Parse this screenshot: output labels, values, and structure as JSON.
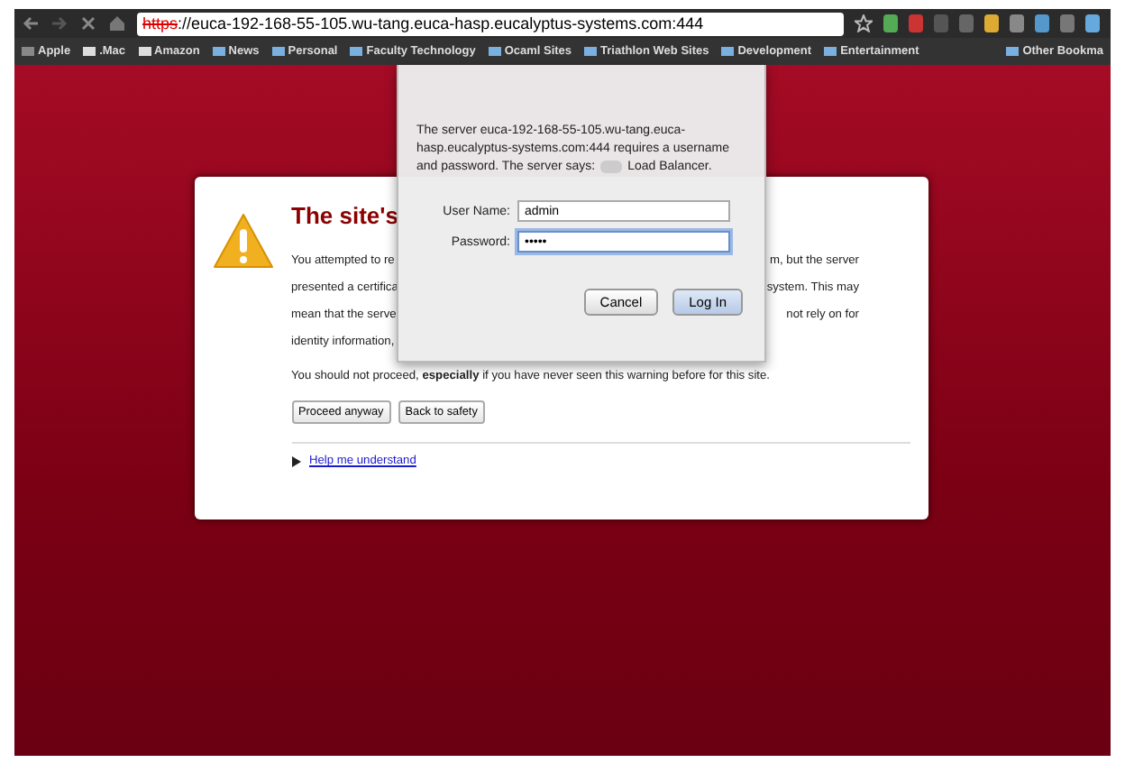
{
  "toolbar": {
    "url_scheme": "https",
    "url_rest": "://euca-192-168-55-105.wu-tang.euca-hasp.eucalyptus-systems.com:444",
    "scheme_insecure": true
  },
  "bookmarks": [
    {
      "label": "Apple",
      "kind": "apple"
    },
    {
      "label": ".Mac",
      "kind": "page"
    },
    {
      "label": "Amazon",
      "kind": "page"
    },
    {
      "label": "News",
      "kind": "folder"
    },
    {
      "label": "Personal",
      "kind": "folder"
    },
    {
      "label": "Faculty Technology",
      "kind": "folder"
    },
    {
      "label": "Ocaml Sites",
      "kind": "folder"
    },
    {
      "label": "Triathlon Web Sites",
      "kind": "folder"
    },
    {
      "label": "Development",
      "kind": "folder"
    },
    {
      "label": "Entertainment",
      "kind": "folder"
    }
  ],
  "other_bookmarks": "Other Bookma",
  "warning": {
    "title": "The site's",
    "lines": [
      {
        "left": "You attempted to re",
        "right": "m, but the server"
      },
      {
        "left": "presented a certifica",
        "right": "system. This may"
      },
      {
        "left": "mean that the serve",
        "right": "not rely on for"
      },
      {
        "left": "identity information,"
      }
    ],
    "advice": "You should not proceed, **especially** if you have never seen this warning before for this site.",
    "buttons": [
      "Proceed anyway",
      "Back to safety"
    ],
    "help_link": "Help me understand",
    "help_expanded": false
  },
  "dialog": {
    "message": "The server euca-192-168-55-105.wu-tang.euca-hasp.eucalyptus-systems.com:444 requires a username and password. The server says:",
    "message_end": "Load Balancer.",
    "fields": [
      {
        "label": "User Name:",
        "value": "admin",
        "focused": false
      },
      {
        "label": "Password:",
        "value": "•••••",
        "focused": true
      }
    ],
    "buttons": [
      {
        "label": "Cancel",
        "default": false
      },
      {
        "label": "Log In",
        "default": true
      }
    ]
  }
}
